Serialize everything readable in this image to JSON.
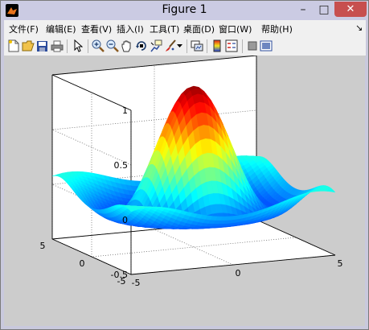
{
  "window": {
    "title": "Figure 1"
  },
  "titlebar_controls": {
    "minimize": "–",
    "maximize": "□",
    "close": "✕"
  },
  "menu": [
    {
      "label": "文件(F)"
    },
    {
      "label": "编辑(E)"
    },
    {
      "label": "查看(V)"
    },
    {
      "label": "插入(I)"
    },
    {
      "label": "工具(T)"
    },
    {
      "label": "桌面(D)"
    },
    {
      "label": "窗口(W)"
    },
    {
      "label": "帮助(H)"
    }
  ],
  "toolbar": [
    {
      "icon": "new-figure-icon"
    },
    {
      "icon": "open-file-icon"
    },
    {
      "icon": "save-icon"
    },
    {
      "icon": "print-icon"
    },
    {
      "icon": "edit-plot-arrow-icon"
    },
    {
      "icon": "zoom-in-icon"
    },
    {
      "icon": "zoom-out-icon"
    },
    {
      "icon": "pan-hand-icon"
    },
    {
      "icon": "rotate-3d-icon"
    },
    {
      "icon": "data-cursor-icon"
    },
    {
      "icon": "brush-icon"
    },
    {
      "icon": "brush-dropdown-icon"
    },
    {
      "icon": "link-plot-icon"
    },
    {
      "icon": "colorbar-icon"
    },
    {
      "icon": "legend-icon"
    },
    {
      "icon": "hide-plot-tools-icon"
    },
    {
      "icon": "show-plot-tools-icon"
    }
  ],
  "colors": {
    "titlebar": "#cbcbe3",
    "figure_bg": "#cccccc",
    "axes_bg": "#ffffff",
    "close_button": "#c74f4f"
  },
  "chart_data": {
    "type": "surface",
    "colormap": "jet",
    "grid": true,
    "box": true,
    "xlim": [
      -5,
      5
    ],
    "ylim": [
      -5,
      5
    ],
    "zlim": [
      -0.5,
      1
    ],
    "x_ticks": [
      "-5",
      "0",
      "5"
    ],
    "y_ticks": [
      "-5",
      "0",
      "5"
    ],
    "z_ticks": [
      "-0.5",
      "0",
      "0.5",
      "1"
    ],
    "peak_value": 1,
    "min_value": -0.5,
    "view": "default 3-D (az -37.5, el 30)"
  }
}
